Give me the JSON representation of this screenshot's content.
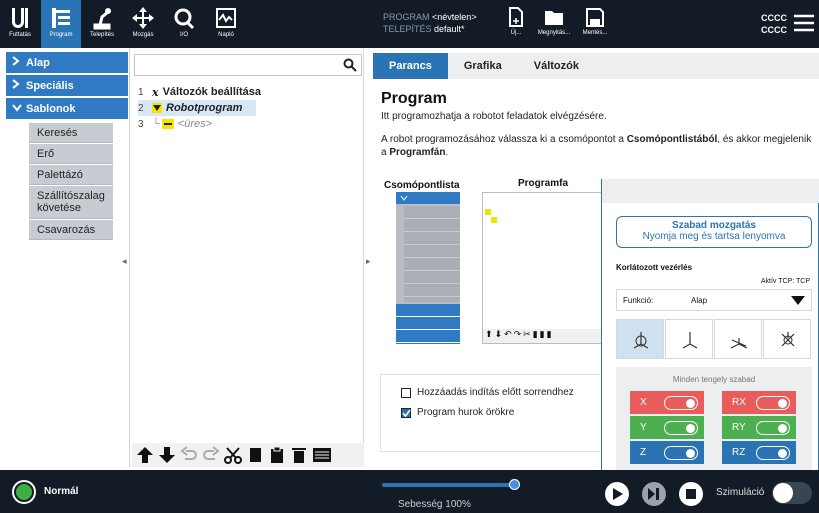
{
  "header": {
    "nav": [
      {
        "label": "Futtatás",
        "icon": "ur-logo-icon"
      },
      {
        "label": "Program",
        "icon": "program-icon"
      },
      {
        "label": "Telepítés",
        "icon": "robot-arm-icon"
      },
      {
        "label": "Mozgás",
        "icon": "move-icon"
      },
      {
        "label": "I/O",
        "icon": "io-icon"
      },
      {
        "label": "Napló",
        "icon": "log-icon"
      }
    ],
    "program_label": "PROGRAM",
    "program_value": "<névtelen>",
    "install_label": "TELEPÍTÉS",
    "install_value": "default*",
    "file_buttons": [
      {
        "label": "Új...",
        "icon": "new-file-icon"
      },
      {
        "label": "Megnyitás...",
        "icon": "folder-icon"
      },
      {
        "label": "Mentés...",
        "icon": "save-icon"
      }
    ],
    "user_line1": "CCCC",
    "user_line2": "CCCC",
    "menu_icon": "hamburger-icon"
  },
  "left_panel": {
    "sections": [
      {
        "label": "Alap",
        "expanded": false
      },
      {
        "label": "Speciális",
        "expanded": false
      },
      {
        "label": "Sablonok",
        "expanded": true
      }
    ],
    "templates": [
      "Keresés",
      "Erő",
      "Palettázó",
      "Szállítószalag követése",
      "Csavarozás"
    ]
  },
  "tree": {
    "search_icon": "search-icon",
    "items": [
      {
        "num": "1",
        "label": "Változók beállítása"
      },
      {
        "num": "2",
        "label": "Robotprogram"
      },
      {
        "num": "3",
        "label": "<üres>"
      }
    ]
  },
  "main": {
    "tabs": [
      "Parancs",
      "Grafika",
      "Változók"
    ],
    "title": "Program",
    "desc1": "Itt programozhatja a robotot feladatok elvégzésére.",
    "desc2a": "A robot programozásához válassza ki a csomópontot a ",
    "desc2b": "Csomópontlistából",
    "desc2c": ", és akkor megjelenik a ",
    "desc2d": "Programfán",
    "desc2e": ".",
    "node_list_label": "Csomópontlista",
    "program_tree_label": "Programfa",
    "opt1": "Hozzáadás indítás előtt sorrendhez",
    "opt1_checked": false,
    "opt2": "Program hurok örökre",
    "opt2_checked": true
  },
  "freedrive": {
    "btn_title": "Szabad mozgatás",
    "btn_sub": "Nyomja meg és tartsa lenyomva",
    "section": "Korlátozott vezérlés",
    "tcp": "Aktív TCP: TCP",
    "func_label": "Funkció:",
    "func_value": "Alap",
    "mode_icons": [
      "all-axes-icon",
      "translation-icon",
      "plane-icon",
      "rotation-icon"
    ],
    "all_free": "Minden tengely szabad",
    "axes": [
      {
        "label": "X",
        "color": "#e85c5c",
        "on": true
      },
      {
        "label": "RX",
        "color": "#e85c5c",
        "on": true
      },
      {
        "label": "Y",
        "color": "#4caf50",
        "on": true
      },
      {
        "label": "RY",
        "color": "#4caf50",
        "on": true
      },
      {
        "label": "Z",
        "color": "#2a74b5",
        "on": true
      },
      {
        "label": "RZ",
        "color": "#2a74b5",
        "on": true
      }
    ]
  },
  "footer": {
    "status": "Normál",
    "speed_label": "Sebesség 100%",
    "speed_value": 1.0,
    "sim_label": "Szimuláció",
    "sim_on": false
  },
  "colors": {
    "accent": "#2a74b5",
    "header": "#131c26",
    "status_ok": "#3cb043"
  }
}
